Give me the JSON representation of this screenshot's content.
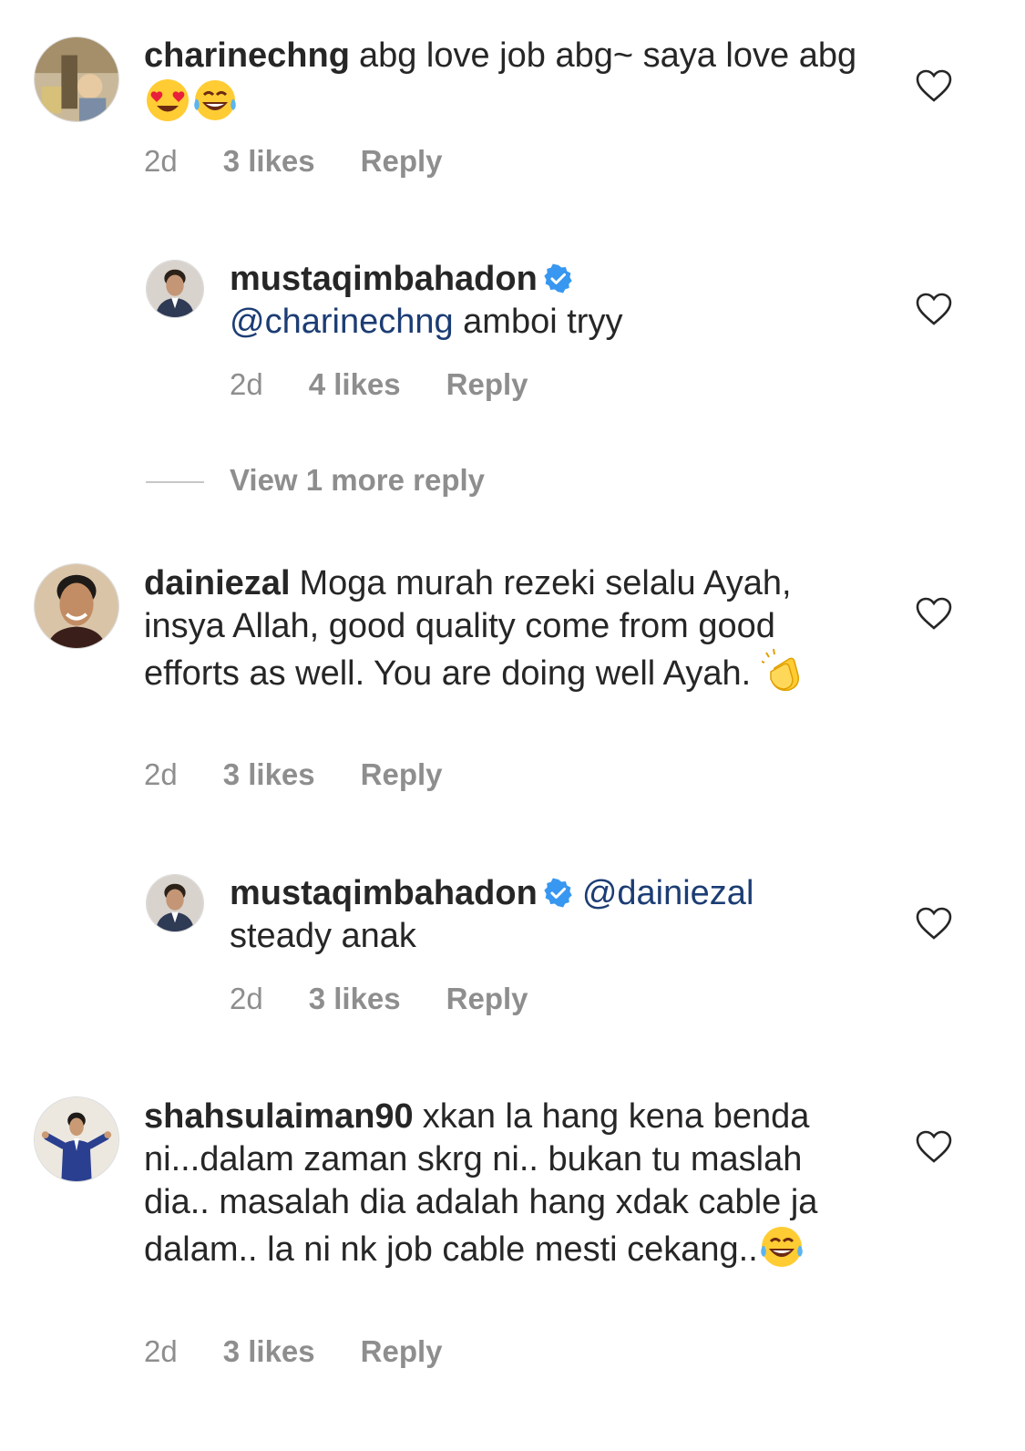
{
  "comments": [
    {
      "username": "charinechng",
      "text": "abg love job abg~ saya love abg",
      "emojis": [
        "smiling-face-with-heart-eyes",
        "face-with-tears-of-joy"
      ],
      "time": "2d",
      "likes": "3 likes",
      "reply_label": "Reply"
    },
    {
      "username": "mustaqimbahadon",
      "verified": true,
      "mention": "@charinechng",
      "text": "amboi tryy",
      "time": "2d",
      "likes": "4 likes",
      "reply_label": "Reply"
    },
    {
      "username": "dainiezal",
      "text": "Moga murah rezeki selalu Ayah, insya Allah, good quality come from good efforts as well. You are doing well Ayah.",
      "emojis": [
        "clapping-hands"
      ],
      "time": "2d",
      "likes": "3 likes",
      "reply_label": "Reply"
    },
    {
      "username": "mustaqimbahadon",
      "verified": true,
      "mention": "@dainiezal",
      "text": "steady anak",
      "time": "2d",
      "likes": "3 likes",
      "reply_label": "Reply"
    },
    {
      "username": "shahsulaiman90",
      "text": "xkan la hang kena benda ni...dalam zaman skrg ni.. bukan tu maslah dia.. masalah dia adalah hang xdak cable ja dalam.. la ni nk job cable mesti cekang..",
      "emojis": [
        "face-with-tears-of-joy"
      ],
      "time": "2d",
      "likes": "3 likes",
      "reply_label": "Reply"
    }
  ],
  "view_more_replies": "View 1 more reply",
  "colors": {
    "text": "#262626",
    "secondary": "#8e8e8e",
    "mention": "#1c3d74",
    "verified": "#3897f0"
  }
}
